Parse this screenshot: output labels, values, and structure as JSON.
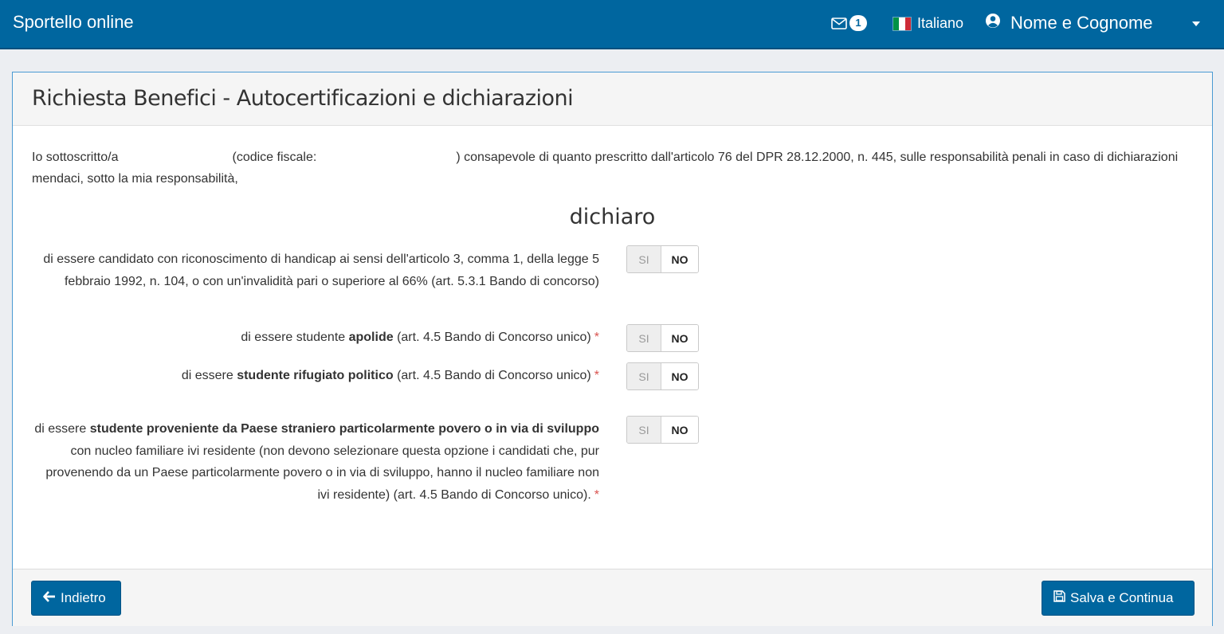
{
  "navbar": {
    "brand": "Sportello online",
    "mail_count": "1",
    "language": "Italiano",
    "user_name": "Nome e Cognome"
  },
  "page": {
    "title": "Richiesta Benefici - Autocertificazioni e dichiarazioni",
    "intro_part1": "Io sottoscritto/a",
    "intro_part2": "(codice fiscale:",
    "intro_part3": ") consapevole di quanto prescritto dall'articolo 76 del DPR 28.12.2000, n. 445, sulle responsabilità penali in caso di dichiarazioni mendaci, sotto la mia responsabilità,",
    "heading": "dichiaro"
  },
  "declarations": [
    {
      "text_before": "di essere candidato con riconoscimento di handicap ai sensi dell'articolo 3, comma 1, della legge 5 febbraio 1992, n. 104, o con un'invalidità pari o superiore al 66% (art. 5.3.1 Bando di concorso)",
      "bold": "",
      "text_after": "",
      "required": "",
      "yes_label": "SI",
      "no_label": "NO",
      "selected": "NO"
    },
    {
      "text_before": "di essere studente ",
      "bold": "apolide",
      "text_after": " (art. 4.5 Bando di Concorso unico)",
      "required": "*",
      "yes_label": "SI",
      "no_label": "NO",
      "selected": "NO"
    },
    {
      "text_before": "di essere ",
      "bold": "studente rifugiato politico",
      "text_after": " (art. 4.5 Bando di Concorso unico)",
      "required": "*",
      "yes_label": "SI",
      "no_label": "NO",
      "selected": "NO"
    },
    {
      "text_before": "di essere ",
      "bold": "studente proveniente da Paese straniero particolarmente povero o in via di sviluppo",
      "text_after": " con nucleo familiare ivi residente (non devono selezionare questa opzione i candidati che, pur provenendo da un Paese particolarmente povero o in via di sviluppo, hanno il nucleo familiare non ivi residente) (art. 4.5 Bando di Concorso unico).",
      "required": "*",
      "yes_label": "SI",
      "no_label": "NO",
      "selected": "NO"
    }
  ],
  "footer": {
    "back_label": "Indietro",
    "save_label": "Salva e Continua"
  },
  "colors": {
    "primary": "#00669f",
    "required": "#d9534f"
  }
}
